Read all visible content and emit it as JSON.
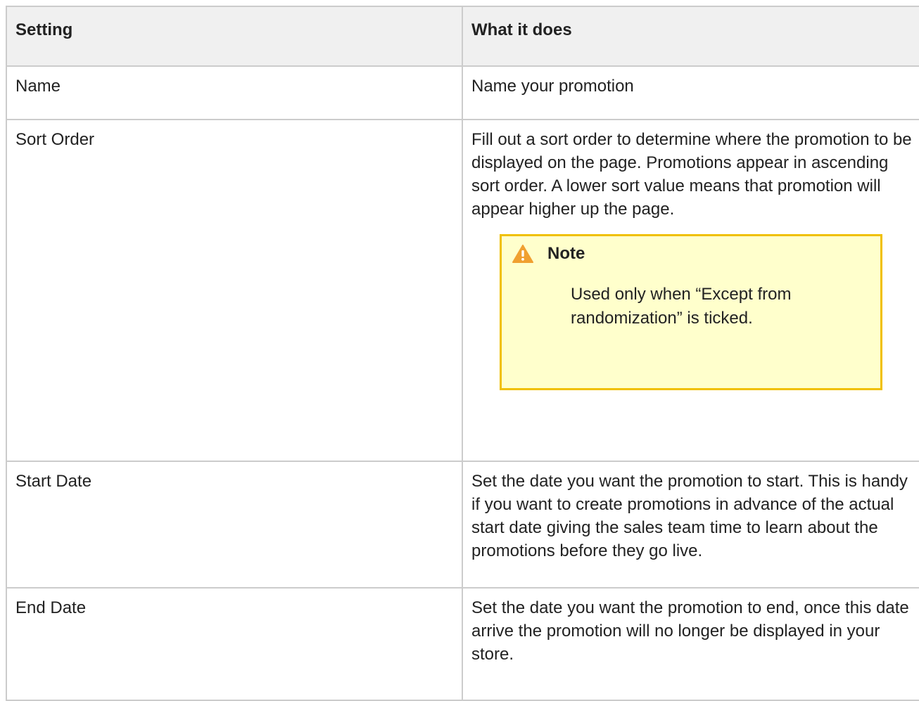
{
  "table": {
    "headers": [
      "Setting",
      "What it does"
    ],
    "rows": [
      {
        "setting": "Name",
        "description": "Name your promotion"
      },
      {
        "setting": "Sort Order",
        "description": "Fill out a sort order to determine where the promotion to be displayed on the page. Promotions appear in ascending sort order. A lower sort value means that promotion will appear higher up the page.",
        "note": {
          "icon": "warning-icon",
          "title": "Note",
          "text": "Used only when “Except from randomization” is ticked."
        }
      },
      {
        "setting": "Start Date",
        "description": "Set the date you want the promotion to start. This is handy if you want to create promotions in advance of the actual start date giving the sales team time to learn about the promotions before they go live."
      },
      {
        "setting": "End Date",
        "description": "Set the date you want the promotion to end, once this date arrive the promotion will no longer be displayed in your store."
      }
    ]
  },
  "colors": {
    "border": "#cccccc",
    "header_bg": "#f0f0f0",
    "note_bg": "#ffffcc",
    "note_border": "#f0c000",
    "warning_icon": "#f0a030"
  }
}
